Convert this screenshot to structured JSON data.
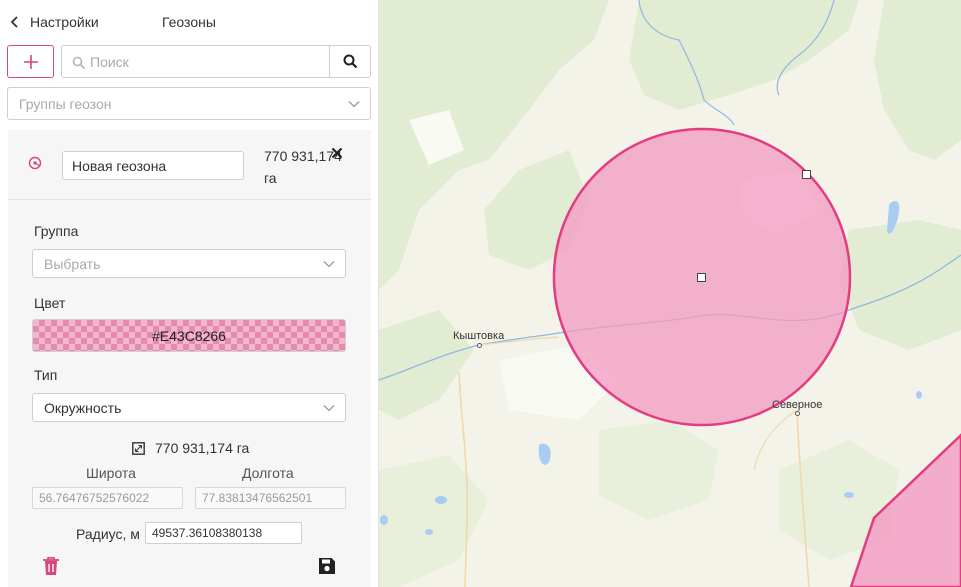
{
  "header": {
    "back_label": "Настройки",
    "title": "Геозоны"
  },
  "toolbar": {
    "add_label": "+",
    "search_placeholder": "Поиск"
  },
  "groups_select": {
    "placeholder": "Группы геозон"
  },
  "geozone": {
    "name_value": "Новая геозона",
    "area_text": "770 931,174 га"
  },
  "form": {
    "group_label": "Группа",
    "group_placeholder": "Выбрать",
    "color_label": "Цвет",
    "color_value": "#E43C8266",
    "type_label": "Тип",
    "type_value": "Окружность",
    "area_text": "770 931,174 га",
    "lat_label": "Широта",
    "lat_value": "56.76476752576022",
    "lon_label": "Долгота",
    "lon_value": "77.83813476562501",
    "radius_label": "Радиус, м",
    "radius_value": "49537.36108380138"
  },
  "map": {
    "towns": [
      "Кыштовка",
      "Северное"
    ],
    "accent": "#E43C82",
    "fill": "#F39AC0"
  },
  "icons": {
    "back": "chevron-left-icon",
    "search": "search-icon",
    "dropdown": "chevron-down-icon",
    "geozone": "geozone-target-icon",
    "close": "close-icon",
    "area": "resize-icon",
    "delete": "trash-icon",
    "save": "save-icon"
  }
}
